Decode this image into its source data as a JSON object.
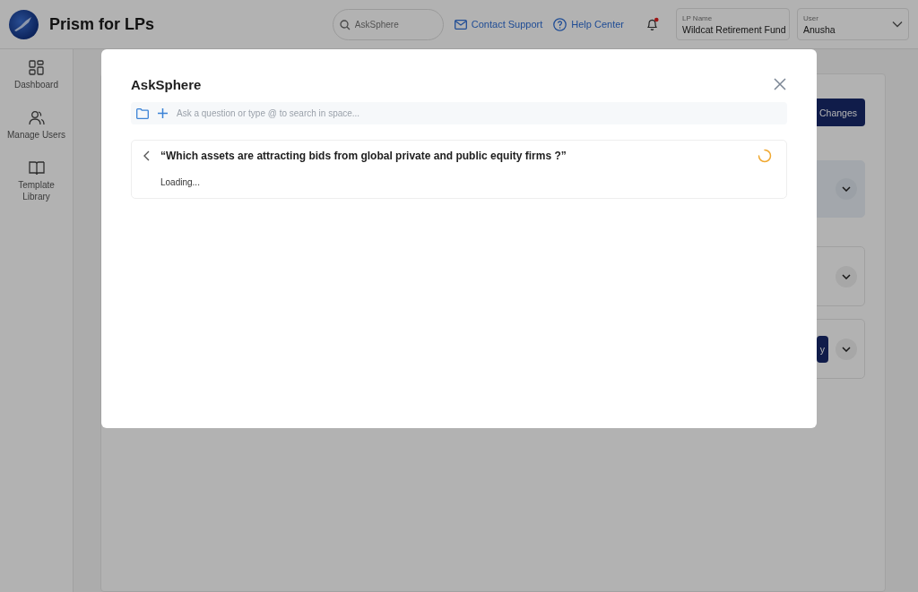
{
  "header": {
    "app_title": "Prism for LPs",
    "search": {
      "placeholder": "AskSphere"
    },
    "links": [
      {
        "label": "Contact Support",
        "kind": "mail"
      },
      {
        "label": "Help Center",
        "kind": "help"
      }
    ],
    "notifications": {
      "unread": true
    },
    "lp_select": {
      "label": "LP Name",
      "value": "Wildcat Retirement Fund"
    },
    "user_select": {
      "label": "User",
      "value": "Anusha"
    }
  },
  "sidebar": {
    "items": [
      {
        "label": "Dashboard",
        "kind": "dashboard"
      },
      {
        "label": "Manage Users",
        "kind": "users"
      },
      {
        "label": "Template Library",
        "kind": "library"
      }
    ]
  },
  "background": {
    "save_button": "Changes",
    "cards": [
      {
        "highlighted": true
      },
      {
        "highlighted": false
      },
      {
        "highlighted": false,
        "button": "y"
      }
    ]
  },
  "modal": {
    "title": "AskSphere",
    "input": {
      "placeholder": "Ask a question or type @ to search in space..."
    },
    "query": {
      "question": "“Which assets are attracting bids from global private and public equity firms ?”",
      "status": "Loading...",
      "loading": true
    }
  }
}
